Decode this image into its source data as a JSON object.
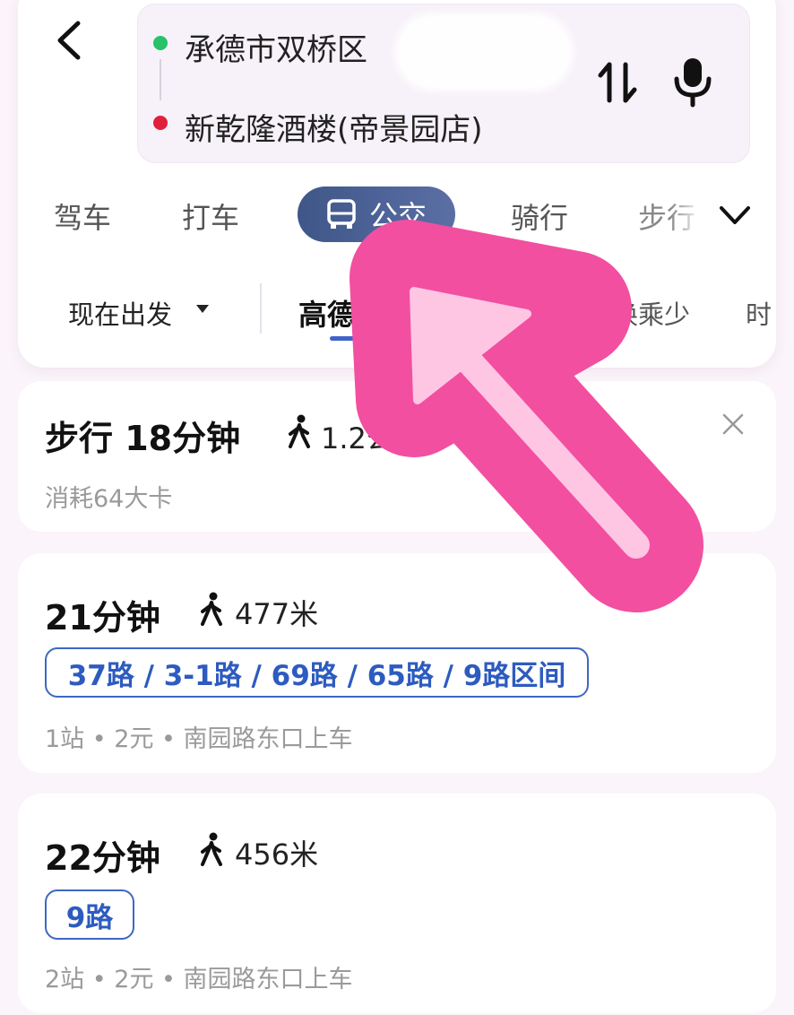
{
  "search": {
    "origin": "承德市双桥区",
    "destination": "新乾隆酒楼(帝景园店)"
  },
  "modes": {
    "drive": "驾车",
    "taxi": "打车",
    "bus": "公交",
    "bike": "骑行",
    "walk": "步行"
  },
  "filters": {
    "depart": "现在出发",
    "recommended": "高德",
    "less_transfer": "换乘少",
    "time": "时"
  },
  "walk_option": {
    "title": "步行 18分钟",
    "distance": "1.2公",
    "calories": "消耗64大卡"
  },
  "routes": [
    {
      "duration": "21分钟",
      "walk_distance": "477米",
      "lines": "37路 / 3-1路 / 69路 / 65路 / 9路区间",
      "details": "1站 • 2元 • 南园路东口上车"
    },
    {
      "duration": "22分钟",
      "walk_distance": "456米",
      "lines": "9路",
      "details": "2站 • 2元 • 南园路东口上车"
    }
  ],
  "colors": {
    "accent": "#3f63c9",
    "bus_tab": "#4a5f94",
    "origin_dot": "#27c26a",
    "destination_dot": "#e0213c",
    "annotation_arrow": "#f24fa0"
  }
}
